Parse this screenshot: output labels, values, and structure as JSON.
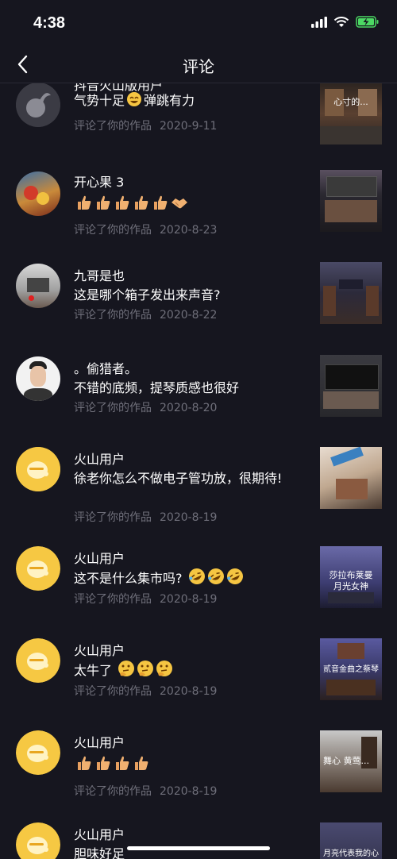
{
  "status": {
    "time": "4:38"
  },
  "nav": {
    "title": "评论"
  },
  "comments": [
    {
      "name": "抖音火山版用户",
      "text": "气势十足",
      "text_after": "弹跳有力",
      "action": "评论了你的作品",
      "date": "2020-9-11"
    },
    {
      "name": "开心果 3",
      "text": "",
      "action": "评论了你的作品",
      "date": "2020-8-23"
    },
    {
      "name": "九哥是也",
      "text": "这是哪个箱子发出来声音?",
      "action": "评论了你的作品",
      "date": "2020-8-22"
    },
    {
      "name": "。偷猎者。",
      "text": "不错的底频，提琴质感也很好",
      "action": "评论了你的作品",
      "date": "2020-8-20"
    },
    {
      "name": "火山用户",
      "text": "徐老你怎么不做电子管功放，很期待!",
      "action": "评论了你的作品",
      "date": "2020-8-19"
    },
    {
      "name": "火山用户",
      "text": "这不是什么集市吗?",
      "action": "评论了你的作品",
      "date": "2020-8-19"
    },
    {
      "name": "火山用户",
      "text": "太牛了",
      "action": "评论了你的作品",
      "date": "2020-8-19"
    },
    {
      "name": "火山用户",
      "text": "",
      "action": "评论了你的作品",
      "date": "2020-8-19"
    },
    {
      "name": "火山用户",
      "text": "胆味好足",
      "action": "",
      "date": ""
    }
  ],
  "thumbnails": [
    {
      "caption": "心寸的..."
    },
    {
      "caption": ""
    },
    {
      "caption": ""
    },
    {
      "caption": ""
    },
    {
      "caption": ""
    },
    {
      "caption": "莎拉布莱曼",
      "caption2": "月光女神"
    },
    {
      "caption": "贰音金曲之蔡琴演唱"
    },
    {
      "caption": "舞心 黄莺..."
    },
    {
      "caption": "月亮代表我的心"
    }
  ]
}
